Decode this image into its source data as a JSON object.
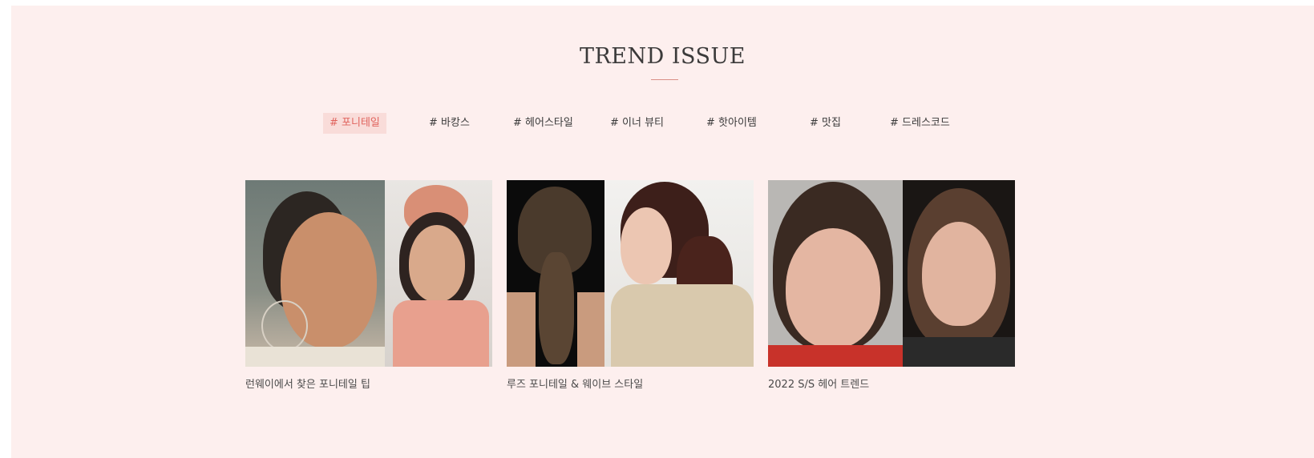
{
  "section": {
    "title": "TREND ISSUE"
  },
  "tabs": [
    {
      "label": "# 포니테일",
      "active": true
    },
    {
      "label": "# 바캉스",
      "active": false
    },
    {
      "label": "# 헤어스타일",
      "active": false
    },
    {
      "label": "# 이너 뷰티",
      "active": false
    },
    {
      "label": "# 핫아이템",
      "active": false
    },
    {
      "label": "# 맛집",
      "active": false
    },
    {
      "label": "# 드레스코드",
      "active": false
    }
  ],
  "cards": [
    {
      "caption": "런웨이에서 찾은 포니테일 팁"
    },
    {
      "caption": "루즈 포니테일 & 웨이브 스타일"
    },
    {
      "caption": "2022 S/S 헤어 트렌드"
    }
  ],
  "colors": {
    "background": "#fdefee",
    "accent": "#e0635d",
    "active_tab_bg": "#f9dcd9"
  }
}
